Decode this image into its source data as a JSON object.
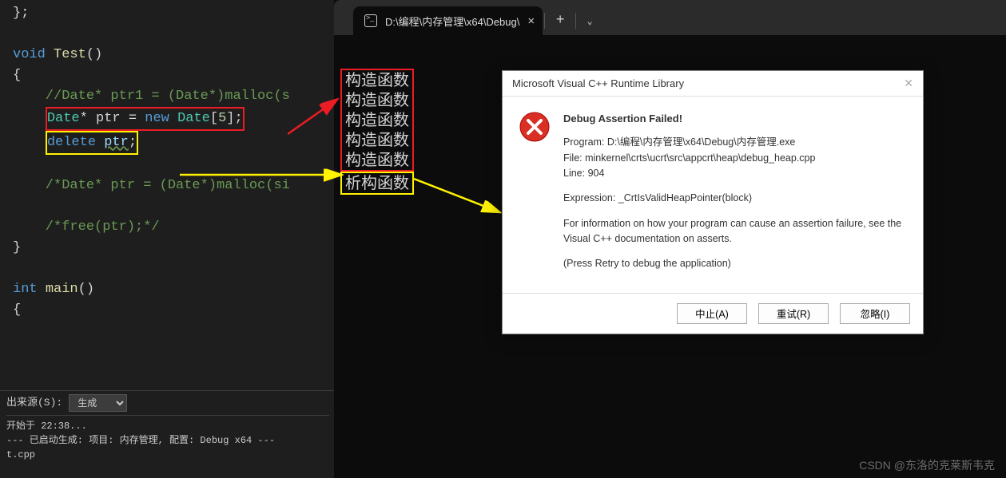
{
  "code": {
    "l1": "};",
    "l3a": "void",
    "l3b": "Test",
    "l3c": "()",
    "l4": "{",
    "l5": "    //Date* ptr1 = (Date*)malloc(s",
    "l6a": "    ",
    "l6_type": "Date",
    "l6b": "* ptr = ",
    "l6_new": "new",
    "l6c": " ",
    "l6_type2": "Date",
    "l6d": "[",
    "l6_num": "5",
    "l6e": "];",
    "l7a": "    ",
    "l7_del": "delete",
    "l7b": " ",
    "l7_var": "ptr",
    "l7c": ";",
    "l9": "    /*Date* ptr = (Date*)malloc(si",
    "l11": "    /*free(ptr);*/",
    "l12": "}",
    "l14a": "int",
    "l14b": " ",
    "l14c": "main",
    "l14d": "()",
    "l15": "{"
  },
  "output": {
    "source_label": "出来源(S):",
    "source_value": "生成",
    "l1": "开始于 22:38...",
    "l2": "--- 已启动生成: 项目: 内存管理, 配置: Debug x64 ---",
    "l3": "t.cpp"
  },
  "tab": {
    "title": "D:\\编程\\内存管理\\x64\\Debug\\"
  },
  "term": {
    "c1": "构造函数",
    "c2": "构造函数",
    "c3": "构造函数",
    "c4": "构造函数",
    "c5": "构造函数",
    "d1": "析构函数"
  },
  "dialog": {
    "title": "Microsoft Visual C++ Runtime Library",
    "heading": "Debug Assertion Failed!",
    "program": "Program: D:\\编程\\内存管理\\x64\\Debug\\内存管理.exe",
    "file": "File: minkernel\\crts\\ucrt\\src\\appcrt\\heap\\debug_heap.cpp",
    "line": "Line: 904",
    "expr": "Expression: _CrtIsValidHeapPointer(block)",
    "info1": "For information on how your program can cause an assertion failure, see the Visual C++ documentation on asserts.",
    "info2": "(Press Retry to debug the application)",
    "btn_abort": "中止(A)",
    "btn_retry": "重试(R)",
    "btn_ignore": "忽略(I)"
  },
  "watermark": "CSDN @东洛的克莱斯韦克"
}
